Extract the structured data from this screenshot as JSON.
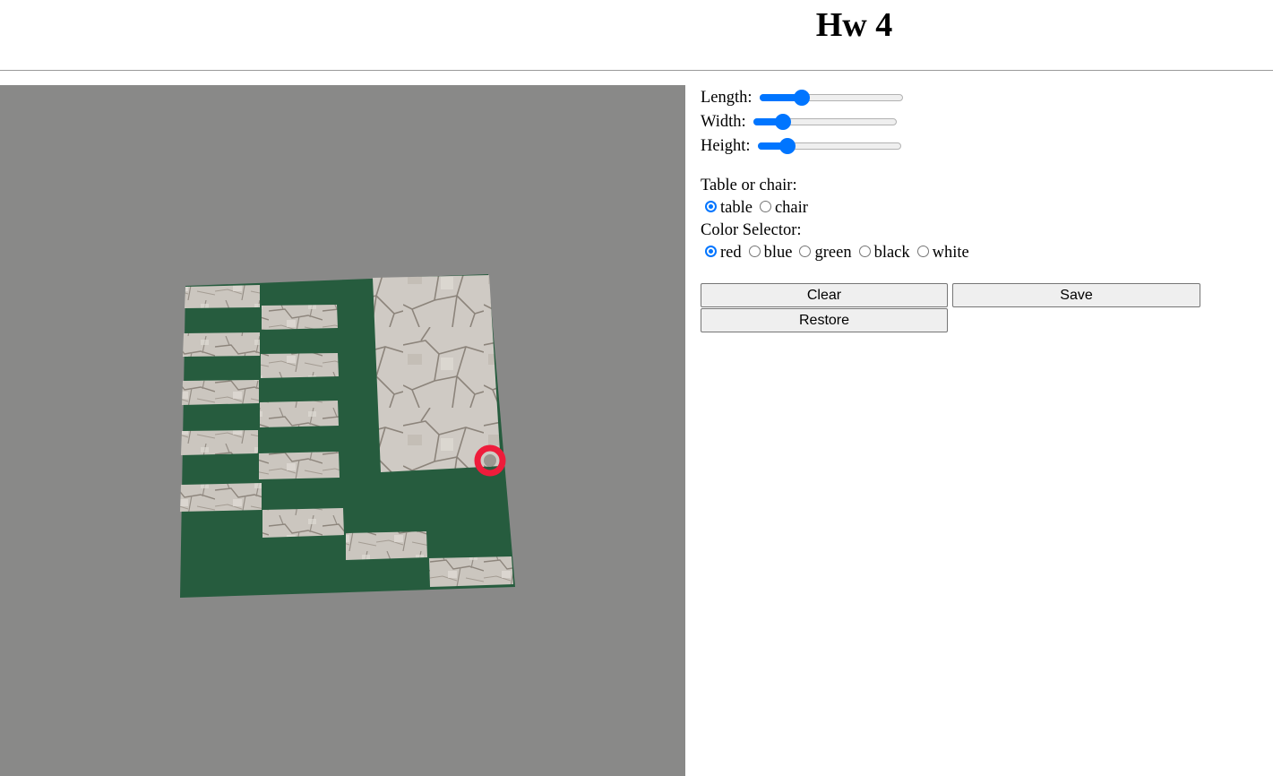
{
  "page": {
    "title": "Hw 4"
  },
  "viewport": {
    "background": "#898988",
    "floor_color": "#265c3e",
    "stone_color": "#c9c3bc",
    "cursor_color": "#ee1c3b"
  },
  "sliders": [
    {
      "label": "Length:",
      "value": 0.27
    },
    {
      "label": "Width:",
      "value": 0.17
    },
    {
      "label": "Height:",
      "value": 0.17
    }
  ],
  "object_type": {
    "label": "Table or chair:",
    "options": [
      "table",
      "chair"
    ],
    "selected": "table"
  },
  "color_selector": {
    "label": "Color Selector:",
    "options": [
      "red",
      "blue",
      "green",
      "black",
      "white"
    ],
    "selected": "red"
  },
  "buttons": {
    "clear": "Clear",
    "save": "Save",
    "restore": "Restore"
  },
  "accent_color": "#0075ff"
}
